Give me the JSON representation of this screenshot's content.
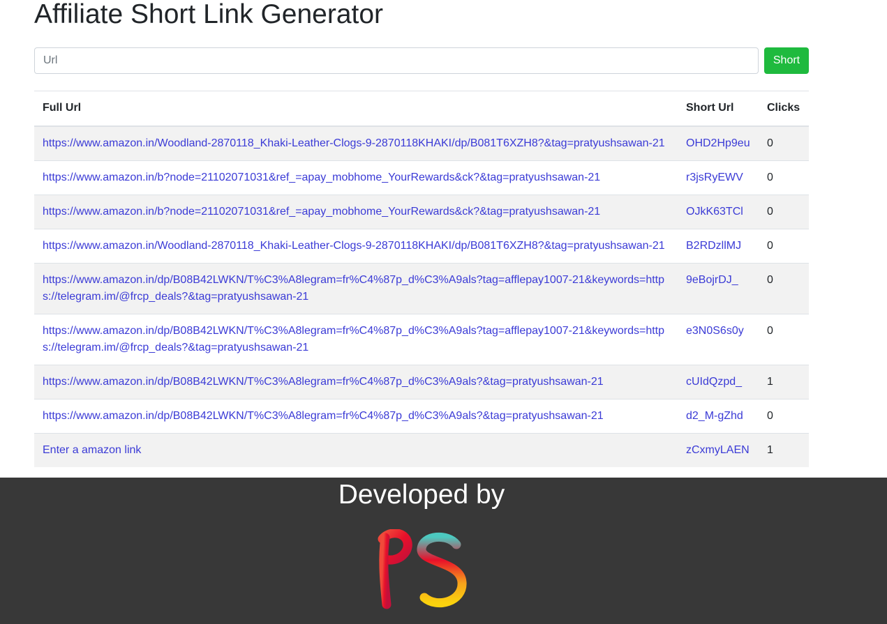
{
  "page": {
    "title": "Affiliate Short Link Generator"
  },
  "form": {
    "url_placeholder": "Url",
    "url_value": "",
    "submit_label": "Short"
  },
  "table": {
    "headers": [
      "Full Url",
      "Short Url",
      "Clicks"
    ],
    "rows": [
      {
        "full_url": "https://www.amazon.in/Woodland-2870118_Khaki-Leather-Clogs-9-2870118KHAKI/dp/B081T6XZH8?&tag=pratyushsawan-21",
        "short_url": "OHD2Hp9eu",
        "clicks": "0"
      },
      {
        "full_url": "https://www.amazon.in/b?node=21102071031&ref_=apay_mobhome_YourRewards&ck?&tag=pratyushsawan-21",
        "short_url": "r3jsRyEWV",
        "clicks": "0"
      },
      {
        "full_url": "https://www.amazon.in/b?node=21102071031&ref_=apay_mobhome_YourRewards&ck?&tag=pratyushsawan-21",
        "short_url": "OJkK63TCl",
        "clicks": "0"
      },
      {
        "full_url": "https://www.amazon.in/Woodland-2870118_Khaki-Leather-Clogs-9-2870118KHAKI/dp/B081T6XZH8?&tag=pratyushsawan-21",
        "short_url": "B2RDzllMJ",
        "clicks": "0"
      },
      {
        "full_url": "https://www.amazon.in/dp/B08B42LWKN/T%C3%A8legram=fr%C4%87p_d%C3%A9als?tag=afflepay1007-21&keywords=https://telegram.im/@frcp_deals?&tag=pratyushsawan-21",
        "short_url": "9eBojrDJ_",
        "clicks": "0"
      },
      {
        "full_url": "https://www.amazon.in/dp/B08B42LWKN/T%C3%A8legram=fr%C4%87p_d%C3%A9als?tag=afflepay1007-21&keywords=https://telegram.im/@frcp_deals?&tag=pratyushsawan-21",
        "short_url": "e3N0S6s0y",
        "clicks": "0"
      },
      {
        "full_url": "https://www.amazon.in/dp/B08B42LWKN/T%C3%A8legram=fr%C4%87p_d%C3%A9als?&tag=pratyushsawan-21",
        "short_url": "cUIdQzpd_",
        "clicks": "1"
      },
      {
        "full_url": "https://www.amazon.in/dp/B08B42LWKN/T%C3%A8legram=fr%C4%87p_d%C3%A9als?&tag=pratyushsawan-21",
        "short_url": "d2_M-gZhd",
        "clicks": "0"
      },
      {
        "full_url": "Enter a amazon link",
        "short_url": "zCxmyLAEN",
        "clicks": "1"
      }
    ]
  },
  "footer": {
    "developed_by": "Developed by",
    "logo_text": "PS"
  },
  "colors": {
    "accent_green": "#1fba3e",
    "link_blue": "#3b3bd6",
    "footer_bg": "#383838"
  }
}
